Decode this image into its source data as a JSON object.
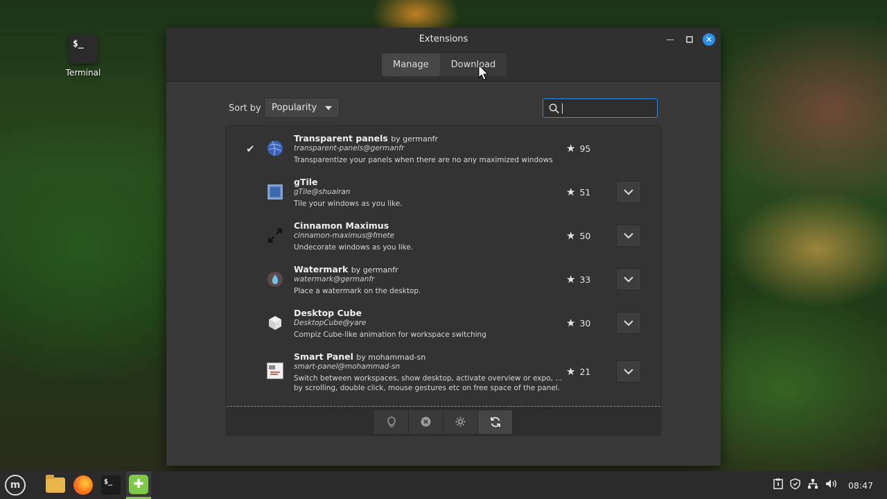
{
  "desktop": {
    "terminal_glyph": "$_",
    "terminal_label": "Terminal"
  },
  "window": {
    "title": "Extensions",
    "tabs": [
      {
        "label": "Manage",
        "active": true
      },
      {
        "label": "Download",
        "active": false
      }
    ]
  },
  "toolbar": {
    "sort_label": "Sort by",
    "sort_value": "Popularity",
    "search_value": "",
    "search_placeholder": ""
  },
  "extensions": [
    {
      "name": "Transparent panels",
      "by": "by germanfr",
      "uuid": "transparent-panels@germanfr",
      "desc": "Transparentize your panels when there are no any maximized windows",
      "rating": "95",
      "installed": true,
      "icon": "globe-icon"
    },
    {
      "name": "gTile",
      "by": "",
      "uuid": "gTile@shuairan",
      "desc": "Tile your windows as you like.",
      "rating": "51",
      "installed": false,
      "icon": "tile-grid-icon"
    },
    {
      "name": "Cinnamon Maximus",
      "by": "",
      "uuid": "cinnamon-maximus@fmete",
      "desc": "Undecorate windows as you like.",
      "rating": "50",
      "installed": false,
      "icon": "expand-arrows-icon"
    },
    {
      "name": "Watermark",
      "by": "by germanfr",
      "uuid": "watermark@germanfr",
      "desc": "Place a watermark on the desktop.",
      "rating": "33",
      "installed": false,
      "icon": "water-drop-icon"
    },
    {
      "name": "Desktop Cube",
      "by": "",
      "uuid": "DesktopCube@yare",
      "desc": "Compiz Cube-like animation for workspace switching",
      "rating": "30",
      "installed": false,
      "icon": "cube-icon"
    },
    {
      "name": "Smart Panel",
      "by": "by mohammad-sn",
      "uuid": "smart-panel@mohammad-sn",
      "desc": "Switch between workspaces, show desktop, activate overview or expo, ...",
      "desc2": "by scrolling, double click, mouse gestures etc on free space of the panel.",
      "rating": "21",
      "installed": false,
      "icon": "smart-panel-icon"
    }
  ],
  "colors": {
    "accent": "#2b8be6",
    "window_bg": "#383838",
    "taskbar_active": "#7ec84a"
  },
  "taskbar": {
    "clock": "08:47",
    "terminal_glyph": "$_"
  }
}
